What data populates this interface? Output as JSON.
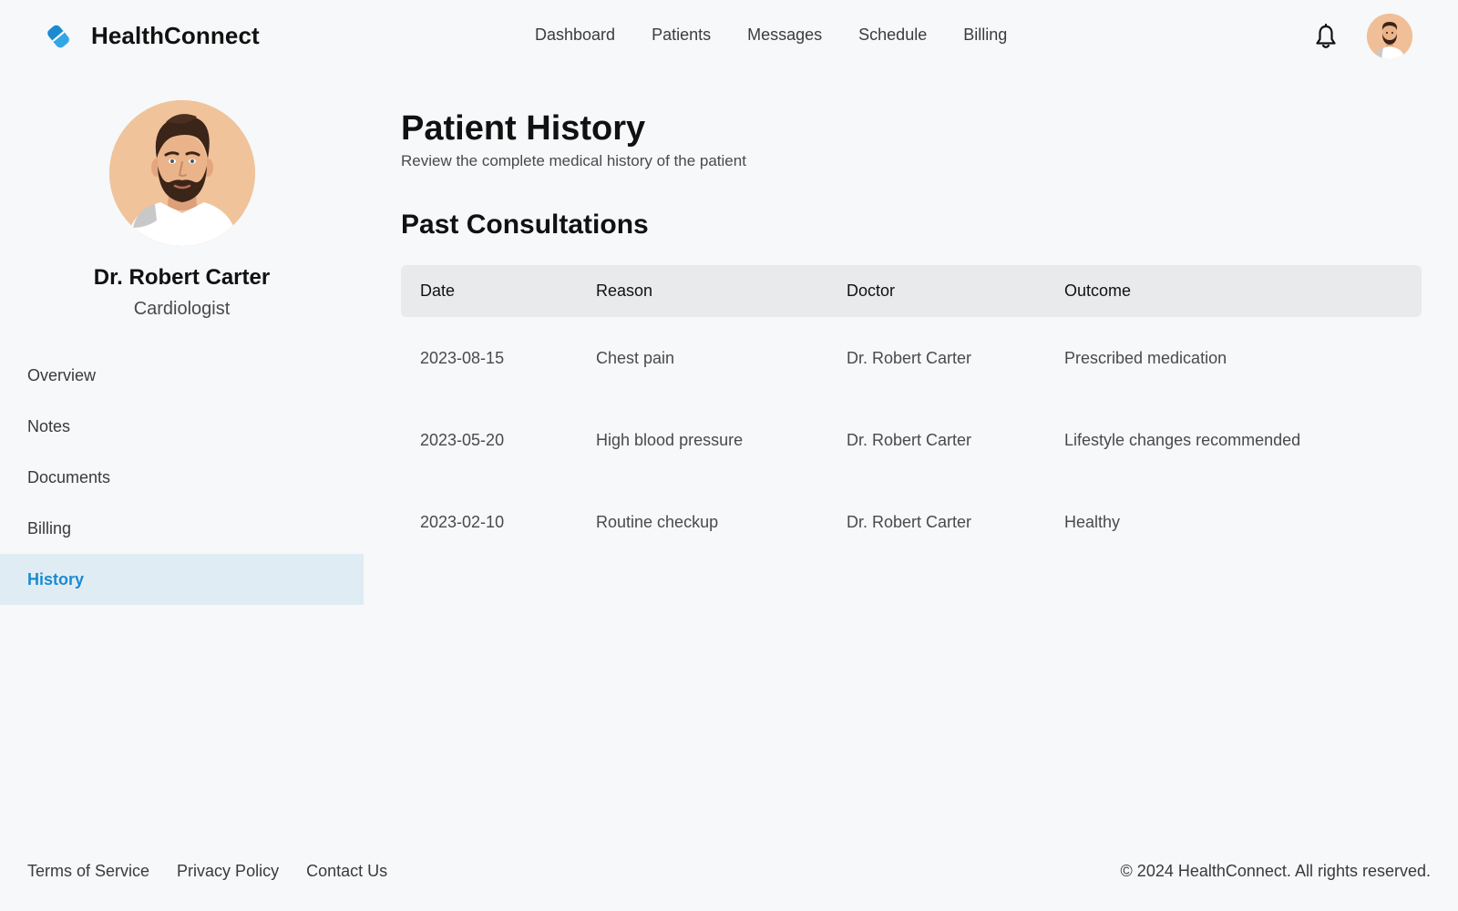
{
  "app": {
    "name": "HealthConnect",
    "brand_color": "#1a8bd0"
  },
  "header": {
    "nav": [
      "Dashboard",
      "Patients",
      "Messages",
      "Schedule",
      "Billing"
    ],
    "icons": {
      "notifications": "bell-icon",
      "user": "avatar"
    }
  },
  "profile": {
    "name": "Dr. Robert Carter",
    "role": "Cardiologist"
  },
  "sidebar": {
    "items": [
      {
        "label": "Overview",
        "active": false
      },
      {
        "label": "Notes",
        "active": false
      },
      {
        "label": "Documents",
        "active": false
      },
      {
        "label": "Billing",
        "active": false
      },
      {
        "label": "History",
        "active": true
      }
    ]
  },
  "main": {
    "title": "Patient History",
    "subtitle": "Review the complete medical history of the patient",
    "section_title": "Past Consultations",
    "table": {
      "columns": [
        "Date",
        "Reason",
        "Doctor",
        "Outcome"
      ],
      "rows": [
        [
          "2023-08-15",
          "Chest pain",
          "Dr. Robert Carter",
          "Prescribed medication"
        ],
        [
          "2023-05-20",
          "High blood pressure",
          "Dr. Robert Carter",
          "Lifestyle changes recommended"
        ],
        [
          "2023-02-10",
          "Routine checkup",
          "Dr. Robert Carter",
          "Healthy"
        ]
      ]
    }
  },
  "footer": {
    "links": [
      "Terms of Service",
      "Privacy Policy",
      "Contact Us"
    ],
    "copyright": "© 2024 HealthConnect. All rights reserved."
  }
}
